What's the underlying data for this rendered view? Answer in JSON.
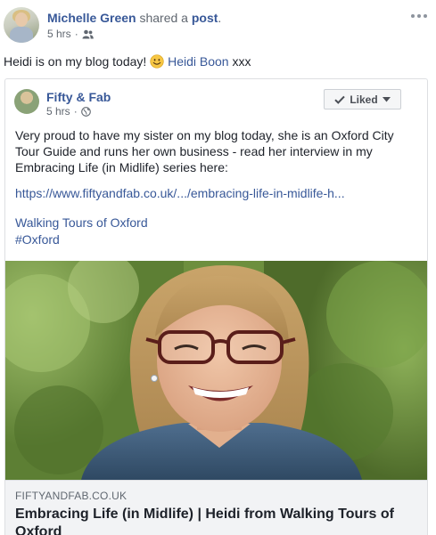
{
  "post": {
    "author": "Michelle Green",
    "action": "shared a",
    "object": "post",
    "period": ".",
    "time": "5 hrs",
    "separator": "·",
    "audience_icon": "friends-icon",
    "text_before": "Heidi is on my blog today!",
    "emoji": "slightly-smiling-face",
    "mention": "Heidi Boon",
    "text_after": "xxx"
  },
  "shared": {
    "page_name": "Fifty & Fab",
    "time": "5 hrs",
    "separator": "·",
    "audience_icon": "globe-icon",
    "liked_label": "Liked",
    "body": "Very proud to have my sister on my blog today, she is an Oxford City Tour Guide and runs her own business - read her interview in my Embracing Life (in Midlife) series here:",
    "link": "https://www.fiftyandfab.co.uk/.../embracing-life-in-midlife-h...",
    "tag1": "Walking Tours of Oxford",
    "tag2": "#Oxford"
  },
  "preview": {
    "domain": "FIFTYANDFAB.CO.UK",
    "title": "Embracing Life (in Midlife) | Heidi from Walking Tours of Oxford"
  },
  "colors": {
    "link": "#385898",
    "text": "#1d2129",
    "muted": "#606770",
    "border": "#dddfe2",
    "preview_bg": "#f2f3f5"
  }
}
